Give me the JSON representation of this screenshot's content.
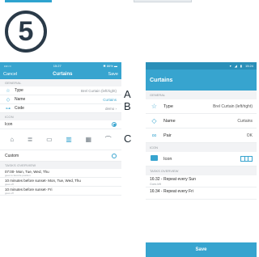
{
  "step": {
    "number": "5"
  },
  "markers": {
    "a": "A",
    "b": "B",
    "c": "C"
  },
  "colors": {
    "accent": "#37a4cf",
    "status_dark": "#2a8fb8",
    "section_bg": "#f2f3f5",
    "badge": "#2a3a48"
  },
  "ios": {
    "status": {
      "carrier": "•••○○",
      "time": "15:27",
      "battery": "✱ 86% ▬"
    },
    "nav": {
      "cancel": "Cancel",
      "title": "Curtains",
      "save": "Save"
    },
    "general_section": "GENERAL",
    "rows": [
      {
        "icon": "star-outline-icon",
        "label": "Type",
        "value": "Brel Curtain (left/right)"
      },
      {
        "icon": "tag-icon",
        "label": "Name",
        "value": "Curtains"
      },
      {
        "icon": "key-icon",
        "label": "Code",
        "value": "demo ›"
      }
    ],
    "icon_section": "ICON",
    "icon_row": {
      "label": "Icon"
    },
    "device_icons": [
      "house-icon",
      "blinds-icon",
      "screen-icon",
      "curtain-open-icon",
      "curtain-closed-icon",
      "lamp-icon"
    ],
    "custom": {
      "label": "Custom"
    },
    "tasks_section": "TASKS OVERVIEW",
    "tasks": [
      {
        "title": "07:00- Mon, Tue, Wed, Thu",
        "sub": "goes to favorite position"
      },
      {
        "title": "10 minutes before sunset- Mon, Tue, Wed, Thu",
        "sub": "goes off"
      },
      {
        "title": "10 minutes before sunset- Fri",
        "sub": "goes off"
      }
    ]
  },
  "android": {
    "status": {
      "wifi": "▾",
      "signal": "◢",
      "battery": "▮",
      "time": "15:24"
    },
    "toolbar_title": "Curtains",
    "general_section": "GENERAL",
    "rows": [
      {
        "icon": "star-outline-icon",
        "label": "Type",
        "value": "Brel Curtain (left/right)"
      },
      {
        "icon": "tag-icon",
        "label": "Name",
        "value": "Curtains"
      },
      {
        "icon": "link-icon",
        "label": "Pair",
        "value": "OK"
      }
    ],
    "icon_section": "ICON",
    "icon_row": {
      "label": "Icon"
    },
    "tasks_section": "TASKS OVERVIEW",
    "tasks": [
      {
        "title": "16:32 - Repeat every Sun",
        "sub": "Goes left"
      },
      {
        "title": "16:34 - Repeat every Fri",
        "sub": ""
      }
    ],
    "save": "Save"
  }
}
